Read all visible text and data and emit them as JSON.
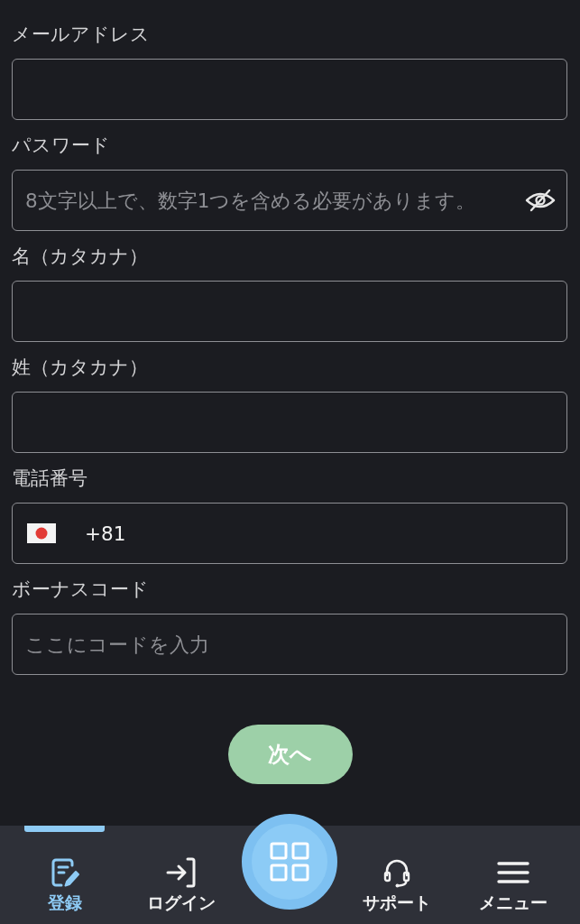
{
  "form": {
    "fields": [
      {
        "kind": "email",
        "label": "メールアドレス"
      },
      {
        "kind": "password",
        "label": "パスワード",
        "placeholder": "8文字以上で、数字1つを含める必要があります。"
      },
      {
        "kind": "text",
        "label": "名（カタカナ）"
      },
      {
        "kind": "text",
        "label": "姓（カタカナ）"
      },
      {
        "kind": "phone",
        "label": "電話番号",
        "value": "+81"
      },
      {
        "kind": "text",
        "label": "ボーナスコード",
        "placeholder": "ここにコードを入力"
      }
    ]
  },
  "next_button": {
    "label": "次へ"
  },
  "bottom_nav": {
    "items": [
      {
        "kind": "register",
        "label": "登録",
        "selected": true
      },
      {
        "kind": "login",
        "label": "ログイン",
        "selected": false
      },
      {
        "kind": "apps",
        "selected": false
      },
      {
        "kind": "support",
        "label": "サポート",
        "selected": false
      },
      {
        "kind": "menu",
        "label": "メニュー",
        "selected": false
      }
    ]
  }
}
